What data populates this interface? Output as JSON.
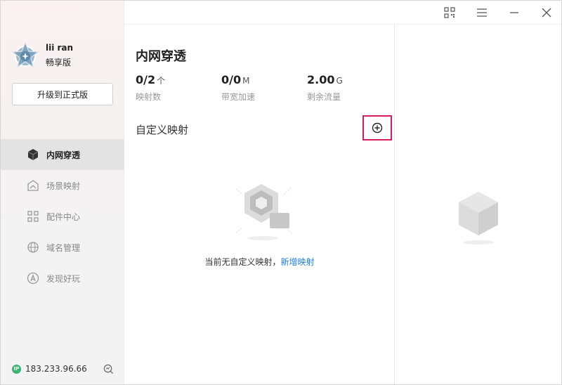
{
  "account": {
    "username": "lii  ran",
    "plan": "畅享版",
    "upgrade_label": "升级到正式版"
  },
  "nav": {
    "items": [
      {
        "label": "内网穿透",
        "icon": "cube-icon",
        "active": true
      },
      {
        "label": "场景映射",
        "icon": "scene-icon",
        "active": false
      },
      {
        "label": "配件中心",
        "icon": "grid-icon",
        "active": false
      },
      {
        "label": "域名管理",
        "icon": "domain-icon",
        "active": false
      },
      {
        "label": "发现好玩",
        "icon": "discover-icon",
        "active": false
      }
    ]
  },
  "footer": {
    "ip_badge": "IP",
    "ip": "183.233.96.66"
  },
  "main": {
    "title": "内网穿透",
    "stats": [
      {
        "value": "0/2",
        "unit": "个",
        "label": "映射数"
      },
      {
        "value": "0/0",
        "unit": "M",
        "label": "带宽加速"
      },
      {
        "value": "2.00",
        "unit": "G",
        "label": "剩余流量"
      }
    ],
    "section_title": "自定义映射",
    "empty_text": "当前无自定义映射，",
    "empty_link": "新增映射"
  },
  "colors": {
    "accent_link": "#1e7fd8",
    "highlight_border": "#d81b60",
    "ip_badge": "#3cb371"
  }
}
